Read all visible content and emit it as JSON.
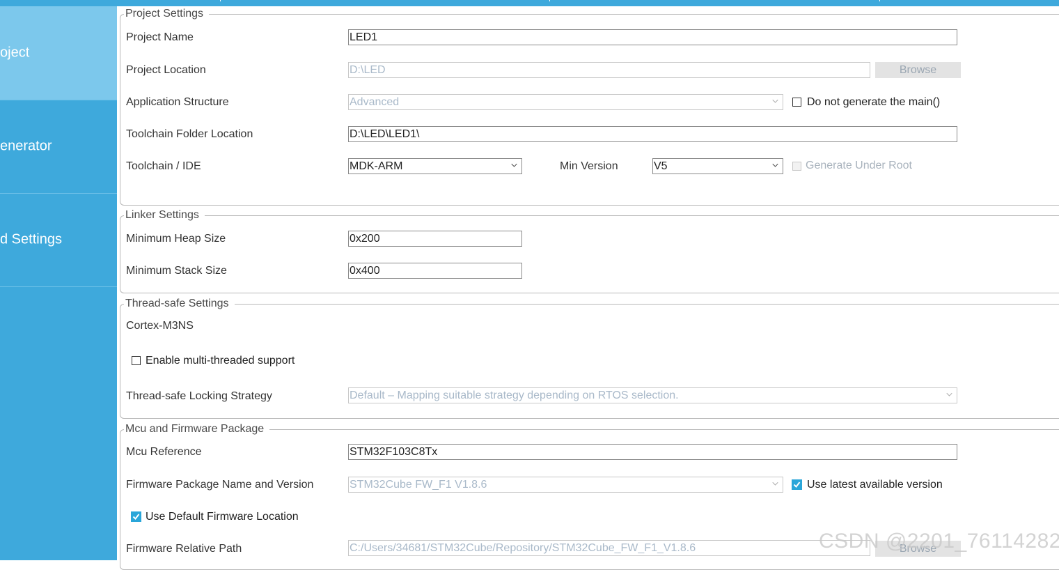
{
  "sidebar": {
    "items": [
      {
        "label": "oject"
      },
      {
        "label": "enerator"
      },
      {
        "label": "d Settings"
      }
    ]
  },
  "project": {
    "title": "Project Settings",
    "name_label": "Project Name",
    "name_value": "LED1",
    "location_label": "Project Location",
    "location_value": "D:\\LED",
    "browse_label": "Browse",
    "structure_label": "Application Structure",
    "structure_value": "Advanced",
    "no_main_label": "Do not generate the main()",
    "toolchain_folder_label": "Toolchain Folder Location",
    "toolchain_folder_value": "D:\\LED\\LED1\\",
    "toolchain_label": "Toolchain / IDE",
    "toolchain_value": "MDK-ARM",
    "min_version_label": "Min Version",
    "min_version_value": "V5",
    "generate_root_label": "Generate Under Root"
  },
  "linker": {
    "title": "Linker Settings",
    "heap_label": "Minimum Heap Size",
    "heap_value": "0x200",
    "stack_label": "Minimum Stack Size",
    "stack_value": "0x400"
  },
  "thread": {
    "title": "Thread-safe Settings",
    "core": "Cortex-M3NS",
    "multithread_label": "Enable multi-threaded support",
    "strategy_label": "Thread-safe Locking Strategy",
    "strategy_value": "Default  –  Mapping suitable strategy depending on RTOS selection."
  },
  "mcu": {
    "title": "Mcu and Firmware Package",
    "reference_label": "Mcu Reference",
    "reference_value": "STM32F103C8Tx",
    "firmware_label": "Firmware Package Name and Version",
    "firmware_value": "STM32Cube FW_F1 V1.8.6",
    "latest_label": "Use latest available version",
    "default_location_label": "Use Default Firmware Location",
    "relative_path_label": "Firmware Relative Path",
    "relative_path_value": "C:/Users/34681/STM32Cube/Repository/STM32Cube_FW_F1_V1.8.6",
    "browse_label": "Browse"
  },
  "watermark": "CSDN @2201_76114282",
  "colors": {
    "sidebar": "#3ea9dc",
    "sidebar_active": "#7cc8ec",
    "checkbox_checked": "#2aa6d9"
  }
}
